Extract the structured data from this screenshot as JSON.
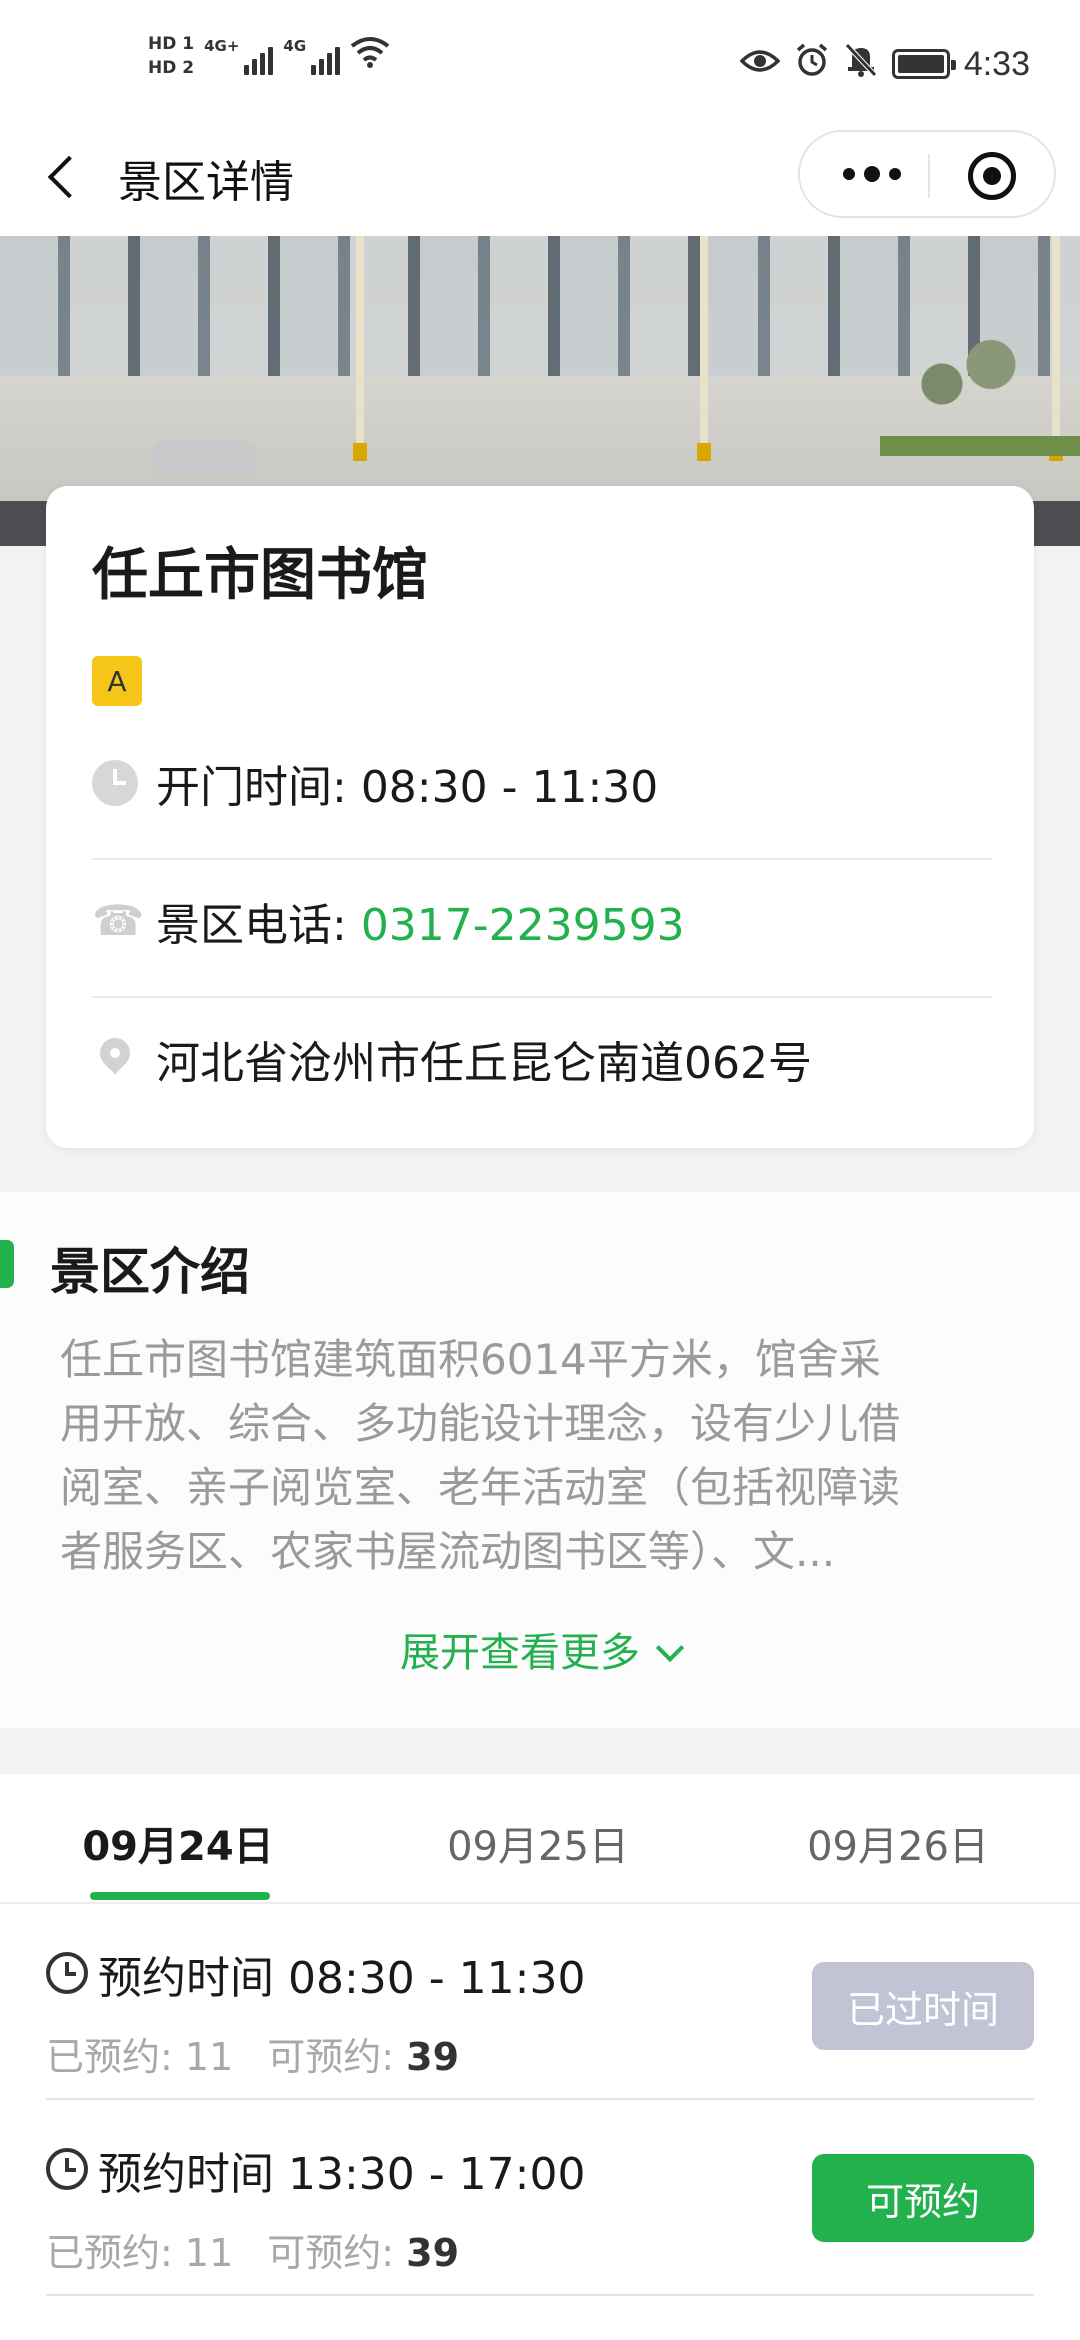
{
  "status_bar": {
    "sim1": "HD 1",
    "sim2": "HD 2",
    "net1": "4G+",
    "net2": "4G",
    "time": "4:33",
    "icons": [
      "eye-icon",
      "alarm-icon",
      "mute-bell-icon",
      "battery-icon"
    ]
  },
  "nav": {
    "title": "景区详情",
    "back_icon": "chevron-left-icon",
    "more_icon": "more-dots-icon",
    "close_icon": "target-circle-icon"
  },
  "place": {
    "name": "任丘市图书馆",
    "grade": "A",
    "hours_label": "开门时间: ",
    "hours": "08:30 - 11:30",
    "phone_label": "景区电话: ",
    "phone": "0317-2239593",
    "address": "河北省沧州市任丘昆仑南道062号"
  },
  "intro": {
    "title": "景区介绍",
    "lines": [
      "任丘市图书馆建筑面积6014平方米，馆舍采",
      "用开放、综合、多功能设计理念，设有少儿借",
      "阅室、亲子阅览室、老年活动室（包括视障读",
      "者服务区、农家书屋流动图书区等）、文..."
    ],
    "expand_label": "展开查看更多"
  },
  "date_tabs": [
    {
      "label": "09月24日",
      "active": true
    },
    {
      "label": "09月25日",
      "active": false
    },
    {
      "label": "09月26日",
      "active": false
    }
  ],
  "slots": [
    {
      "time_label": "预约时间 08:30 - 11:30",
      "booked_label": "已预约: ",
      "booked": "11",
      "available_label": "可预约: ",
      "available": "39",
      "button": "已过时间"
    },
    {
      "time_label": "预约时间 13:30 - 17:00",
      "booked_label": "已预约: ",
      "booked": "11",
      "available_label": "可预约: ",
      "available": "39",
      "button": "可预约"
    }
  ],
  "colors": {
    "accent": "#22b14c",
    "grade_badge": "#f5c518",
    "disabled_button": "#c2c4d6"
  }
}
